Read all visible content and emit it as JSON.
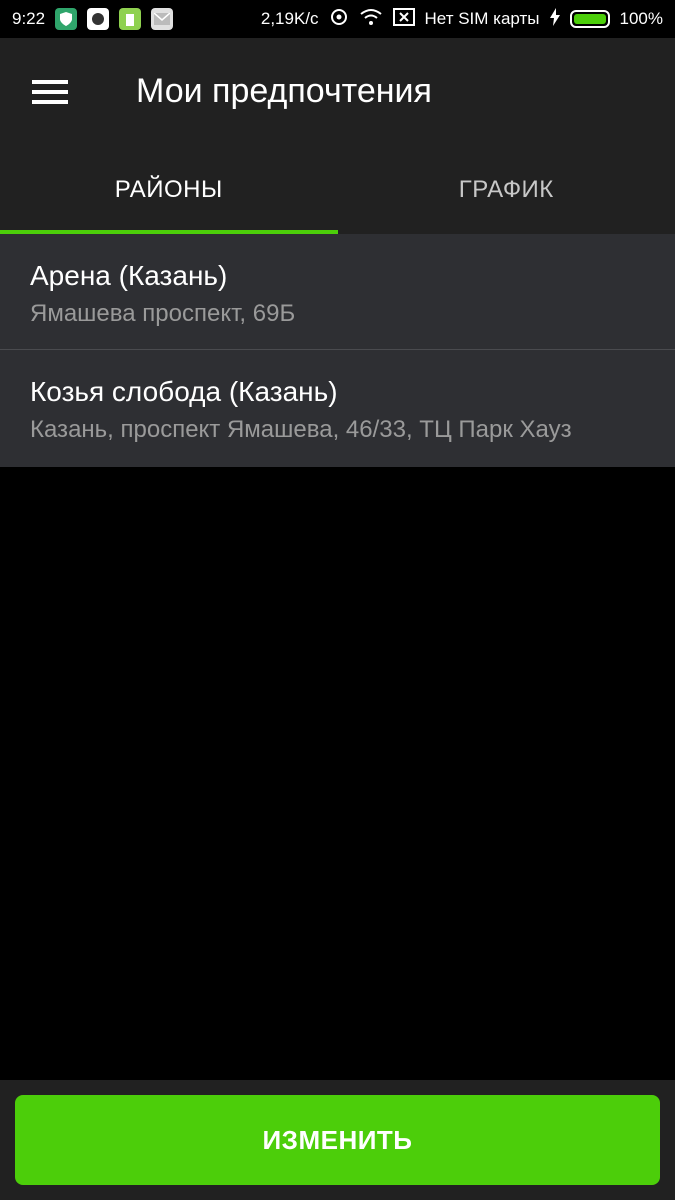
{
  "status_bar": {
    "time": "9:22",
    "speed": "2,19K/c",
    "sim": "Нет SIM карты",
    "battery": "100%"
  },
  "app_bar": {
    "title": "Мои предпочтения"
  },
  "tabs": [
    {
      "label": "РАЙОНЫ",
      "active": true
    },
    {
      "label": "ГРАФИК",
      "active": false
    }
  ],
  "locations": [
    {
      "title": "Арена (Казань)",
      "address": "Ямашева проспект, 69Б"
    },
    {
      "title": "Козья слобода (Казань)",
      "address": "Казань, проспект Ямашева, 46/33, ТЦ Парк Хауз"
    }
  ],
  "action_button": {
    "label": "ИЗМЕНИТЬ"
  },
  "colors": {
    "accent": "#4cce0a",
    "app_bar": "#212121",
    "list_bg": "#2e2f33"
  }
}
